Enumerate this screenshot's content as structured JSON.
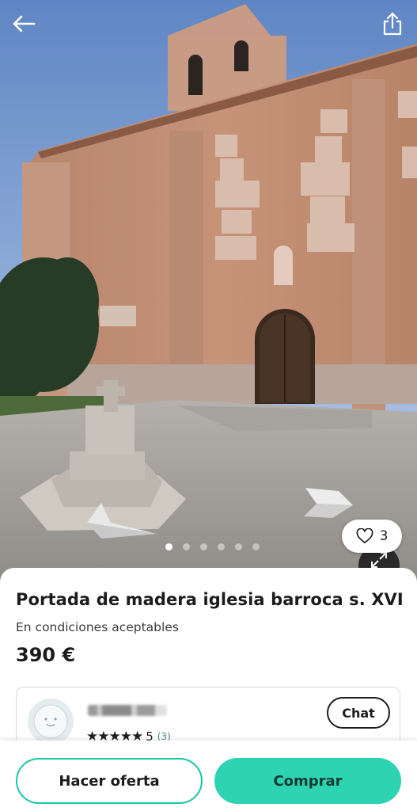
{
  "product": {
    "title": "Portada de madera iglesia barroca s. XVI",
    "condition": "En condiciones aceptables",
    "price": "390 €"
  },
  "gallery": {
    "image_count": 6,
    "active_index": 0,
    "likes": "3"
  },
  "seller": {
    "rating_stars": "★★★★★",
    "rating_value": "5",
    "review_count": "(3)",
    "chat_label": "Chat"
  },
  "actions": {
    "offer_label": "Hacer oferta",
    "buy_label": "Comprar"
  },
  "icons": {
    "back": "arrow-left-icon",
    "share": "share-icon",
    "like": "heart-outline-icon",
    "expand": "expand-icon",
    "avatar": "default-avatar-icon"
  },
  "colors": {
    "accent": "#2ed3b1",
    "accent_border": "#19c5a6",
    "text": "#1c1c1c"
  }
}
